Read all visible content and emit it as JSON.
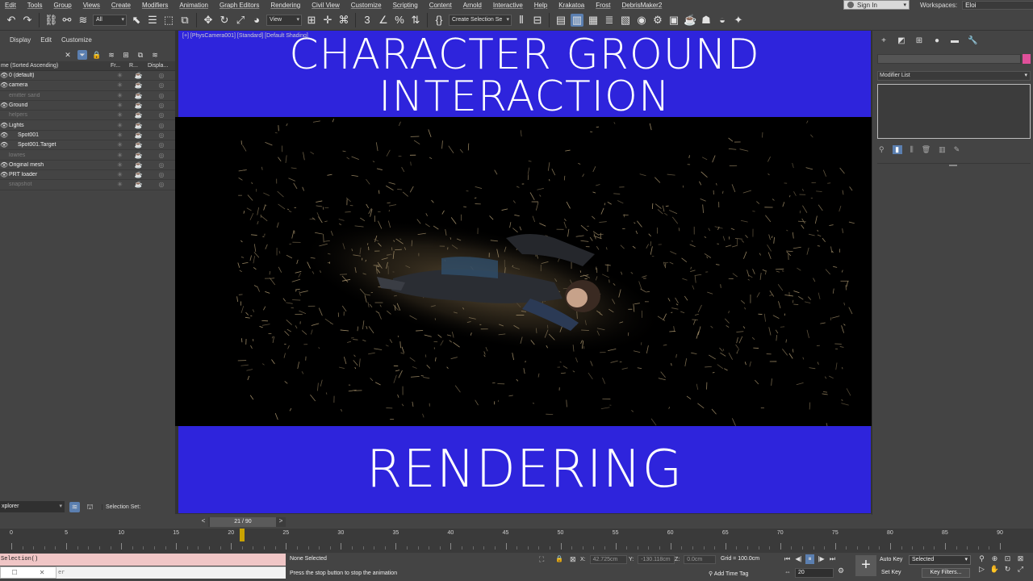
{
  "menu": [
    "Edit",
    "Tools",
    "Group",
    "Views",
    "Create",
    "Modifiers",
    "Animation",
    "Graph Editors",
    "Rendering",
    "Civil View",
    "Customize",
    "Scripting",
    "Content",
    "Arnold",
    "Interactive",
    "Help",
    "Krakatoa",
    "Frost",
    "DebrisMaker2"
  ],
  "signin": {
    "label": "Sign In"
  },
  "workspaces": {
    "label": "Workspaces:",
    "value": "Eloi"
  },
  "toolbar": {
    "filter_value": "All",
    "view_value": "View",
    "selection_set": "Create Selection Se"
  },
  "explorer": {
    "tabs": [
      "Display",
      "Edit",
      "Customize"
    ],
    "columns": [
      "me (Sorted Ascending)",
      "Fr...",
      "R...",
      "Displa..."
    ],
    "rows": [
      {
        "name": "0 (default)",
        "dim": false,
        "eye": true,
        "indent": 0
      },
      {
        "name": "camera",
        "dim": false,
        "eye": true,
        "indent": 0
      },
      {
        "name": "emitter sand",
        "dim": true,
        "eye": false,
        "indent": 0
      },
      {
        "name": "Ground",
        "dim": false,
        "eye": true,
        "indent": 0
      },
      {
        "name": "helpers",
        "dim": true,
        "eye": false,
        "indent": 0
      },
      {
        "name": "Lights",
        "dim": false,
        "eye": true,
        "indent": 0
      },
      {
        "name": "Spot001",
        "dim": false,
        "eye": true,
        "indent": 1
      },
      {
        "name": "Spot001.Target",
        "dim": false,
        "eye": true,
        "indent": 1
      },
      {
        "name": "lowres",
        "dim": true,
        "eye": false,
        "indent": 0
      },
      {
        "name": "Original mesh",
        "dim": false,
        "eye": true,
        "indent": 0
      },
      {
        "name": "PRT loader",
        "dim": false,
        "eye": true,
        "indent": 0
      },
      {
        "name": "snapshot",
        "dim": true,
        "eye": false,
        "indent": 0
      }
    ],
    "footer_dropdown": "xplorer",
    "selection_set_label": "Selection Set:"
  },
  "viewport": {
    "label": "[+] [PhysCamera001] [Standard] [Default Shading]",
    "title_top_line1": "CHARACTER GROUND",
    "title_top_line2": "INTERACTION",
    "title_bottom": "RENDERING",
    "banner_color": "#2e24dc"
  },
  "command_panel": {
    "modifier_list": "Modifier List",
    "object_color": "#e0509a"
  },
  "time_slider": {
    "label": "21 / 90",
    "current_frame": 21,
    "total_frames": 90
  },
  "trackbar": {
    "labels": [
      0,
      5,
      10,
      15,
      20,
      25,
      30,
      35,
      40,
      45,
      50,
      55,
      60,
      65,
      70,
      75,
      80,
      85,
      90
    ]
  },
  "status": {
    "maxscript_line1": "Selection()",
    "maxscript_line2": "er",
    "none_selected": "None Selected",
    "prompt": "Press the stop button to stop the animation",
    "x_label": "X:",
    "x_value": "42.725cm",
    "y_label": "Y:",
    "y_value": "-130.118cm",
    "z_label": "Z:",
    "z_value": "0.0cm",
    "grid": "Grid = 100.0cm",
    "add_time_tag": "Add Time Tag",
    "frame_value": "20",
    "auto_key": "Auto Key",
    "set_key": "Set Key",
    "selected_dd": "Selected",
    "key_filters": "Key Filters..."
  }
}
